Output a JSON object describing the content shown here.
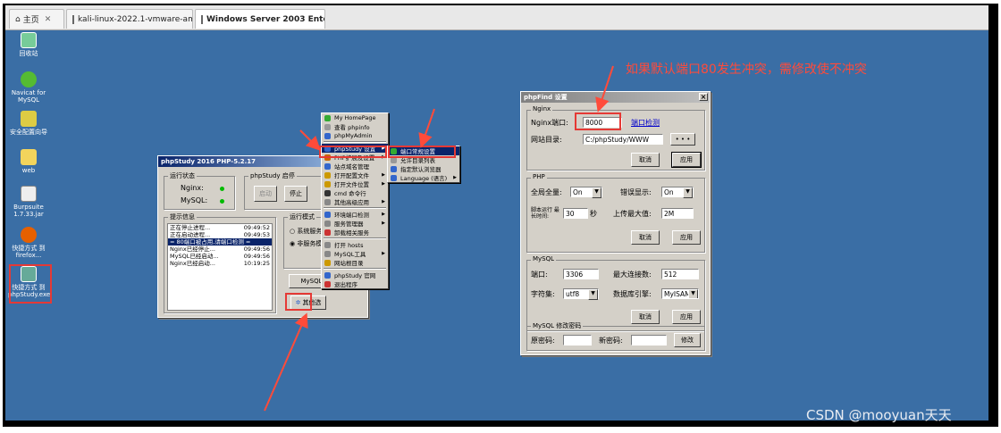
{
  "browser": {
    "tabs": [
      {
        "label": "主页"
      },
      {
        "label": "kali-linux-2022.1-vmware-amd64"
      },
      {
        "label": "Windows Server 2003 Enter..."
      }
    ]
  },
  "desktop_icons": [
    {
      "label": "回收站"
    },
    {
      "label": "Navicat for MySQL"
    },
    {
      "label": "安全配置向导"
    },
    {
      "label": "web"
    },
    {
      "label": "Burpsuite 1.7.33.jar"
    },
    {
      "label": "快捷方式 到 firefox..."
    },
    {
      "label": "快捷方式 到 phpStudy.exe"
    }
  ],
  "phpstudy": {
    "title": "phpStudy 2016    PHP-5.2.17",
    "status_group": "运行状态",
    "nginx": "Nginx:",
    "mysql": "MySQL:",
    "startstop_group": "phpStudy 启停",
    "start_btn": "启动",
    "stop_btn": "停止",
    "info_group": "提示信息",
    "log": [
      {
        "text": "正在停止进程...",
        "time": "09:49:52"
      },
      {
        "text": "正在启动进程...",
        "time": "09:49:53"
      },
      {
        "text": "= 80端口被占用,请端口检测 =",
        "time": ""
      },
      {
        "text": "Nginx已经停止...",
        "time": "09:49:56"
      },
      {
        "text": "MySQL已经启动...",
        "time": "09:49:56"
      },
      {
        "text": "Nginx已经启动...",
        "time": "10:19:25"
      }
    ],
    "mode_group": "运行模式",
    "mode1": "系统服务",
    "mode2": "非服务模",
    "mysql_btn": "MySQL管",
    "other_btn": "其他选"
  },
  "menu": {
    "items": [
      {
        "label": "My HomePage",
        "arrow": ""
      },
      {
        "label": "查看 phpinfo",
        "arrow": ""
      },
      {
        "label": "phpMyAdmin",
        "arrow": ""
      },
      {
        "label": "phpStudy 设置",
        "arrow": "▶"
      },
      {
        "label": "PHP扩展及设置",
        "arrow": "▶"
      },
      {
        "label": "站点域名管理",
        "arrow": ""
      },
      {
        "label": "打开配置文件",
        "arrow": "▶"
      },
      {
        "label": "打开文件位置",
        "arrow": "▶"
      },
      {
        "label": "cmd 命令行",
        "arrow": ""
      },
      {
        "label": "其他高级应用",
        "arrow": "▶"
      },
      {
        "label": "环境端口检测",
        "arrow": "▶"
      },
      {
        "label": "服务管理器",
        "arrow": "▶"
      },
      {
        "label": "卸载相关服务",
        "arrow": ""
      },
      {
        "label": "打开 hosts",
        "arrow": ""
      },
      {
        "label": "MySQL工具",
        "arrow": "▶"
      },
      {
        "label": "网站根目录",
        "arrow": ""
      },
      {
        "label": "phpStudy 官网",
        "arrow": ""
      },
      {
        "label": "退出程序",
        "arrow": ""
      }
    ],
    "submenu": [
      {
        "label": "端口常规设置",
        "arrow": ""
      },
      {
        "label": "允许目录列表",
        "arrow": ""
      },
      {
        "label": "指定默认浏览器",
        "arrow": ""
      },
      {
        "label": "Language (语言)",
        "arrow": "▶"
      }
    ]
  },
  "dialog": {
    "title": "phpFind 设置",
    "close": "×",
    "nginx_group": "Nginx",
    "port_label": "Nginx端口:",
    "port_value": "8000",
    "port_check": "端口检测",
    "webdir_label": "网站目录:",
    "webdir_value": "C:/phpStudy/WWW",
    "browse": "• • •",
    "cancel": "取消",
    "apply": "应用",
    "php_group": "PHP",
    "globals_label": "全局全量:",
    "globals_value": "On",
    "errors_label": "错误显示:",
    "errors_value": "On",
    "timeout_label": "脚本运行 最长时间:",
    "timeout_value": "30",
    "timeout_unit": "秒",
    "upload_label": "上传最大值:",
    "upload_value": "2M",
    "mysql_group": "MySQL",
    "mport_label": "端口:",
    "mport_value": "3306",
    "maxconn_label": "最大连接数:",
    "maxconn_value": "512",
    "charset_label": "字符集:",
    "charset_value": "utf8",
    "engine_label": "数据库引擎:",
    "engine_value": "MyISAM",
    "pwd_group": "MySQL 修改密码",
    "oldpwd_label": "原密码:",
    "newpwd_label": "新密码:",
    "modify": "修改"
  },
  "annotation": "如果默认端口80发生冲突，需修改使不冲突",
  "watermark": "CSDN @mooyuan天天",
  "colors": {
    "desktop": "#3a6ea5",
    "annotation": "#ff4b3a",
    "highlight": "#0a246a"
  }
}
